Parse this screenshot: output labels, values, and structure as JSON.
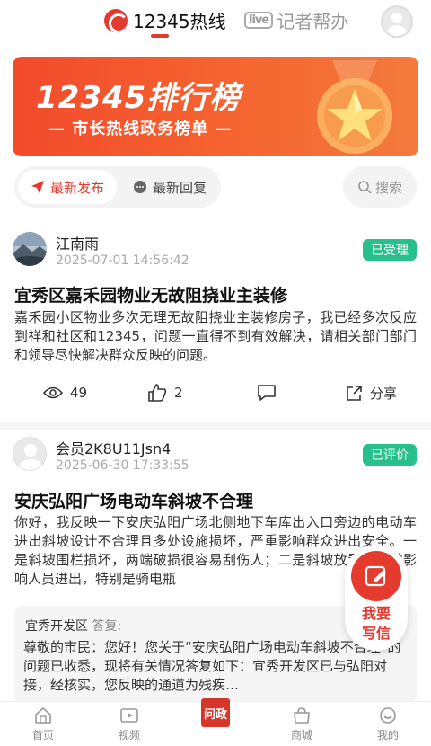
{
  "header": {
    "tab_hotline": "12345热线",
    "tab_reporter": "记者帮办",
    "logo_badge": "12345",
    "live_logo": "live",
    "active_color": "#e23a2e"
  },
  "banner": {
    "title": "12345排行榜",
    "subtitle": "— 市长热线政务榜单 —"
  },
  "filters": {
    "latest_publish": "最新发布",
    "latest_reply": "最新回复",
    "search_placeholder": "搜索"
  },
  "posts": [
    {
      "author": "江南雨",
      "time": "2025-07-01 14:56:42",
      "status": "已受理",
      "title": "宜秀区嘉禾园物业无故阻挠业主装修",
      "body": "嘉禾园小区物业多次无理无故阻挠业主装修房子，我已经多次反应到祥和社区和12345，问题一直得不到有效解决，请相关部门部门和领导尽快解决群众反映的问题。",
      "views": "49",
      "likes": "2",
      "share": "分享"
    },
    {
      "author": "会员2K8U11Jsn4",
      "time": "2025-06-30 17:33:55",
      "status": "已评价",
      "title": "安庆弘阳广场电动车斜坡不合理",
      "body": "你好，我反映一下安庆弘阳广场北侧地下车库出入口旁边的电动车进出斜坡设计不合理且多处设施损坏，严重影响群众进出安全。一是斜坡围栏损坏，两端破损很容易刮伤人；二是斜坡放置石头墩影响人员进出，特别是骑电瓶",
      "reply": {
        "department": "宜秀开发区",
        "label": "答复:",
        "text": "尊敬的市民：您好！您关于“安庆弘阳广场电动车斜坡不合理”的问题已收悉，现将有关情况答复如下：宜秀开发区已与弘阳对接，经核实，您反映的通道为残疾…"
      }
    }
  ],
  "float_button": {
    "line1": "我要",
    "line2": "写信"
  },
  "nav": {
    "home": "首页",
    "video": "视频",
    "center": "问政",
    "mall": "商城",
    "mine": "我的"
  }
}
